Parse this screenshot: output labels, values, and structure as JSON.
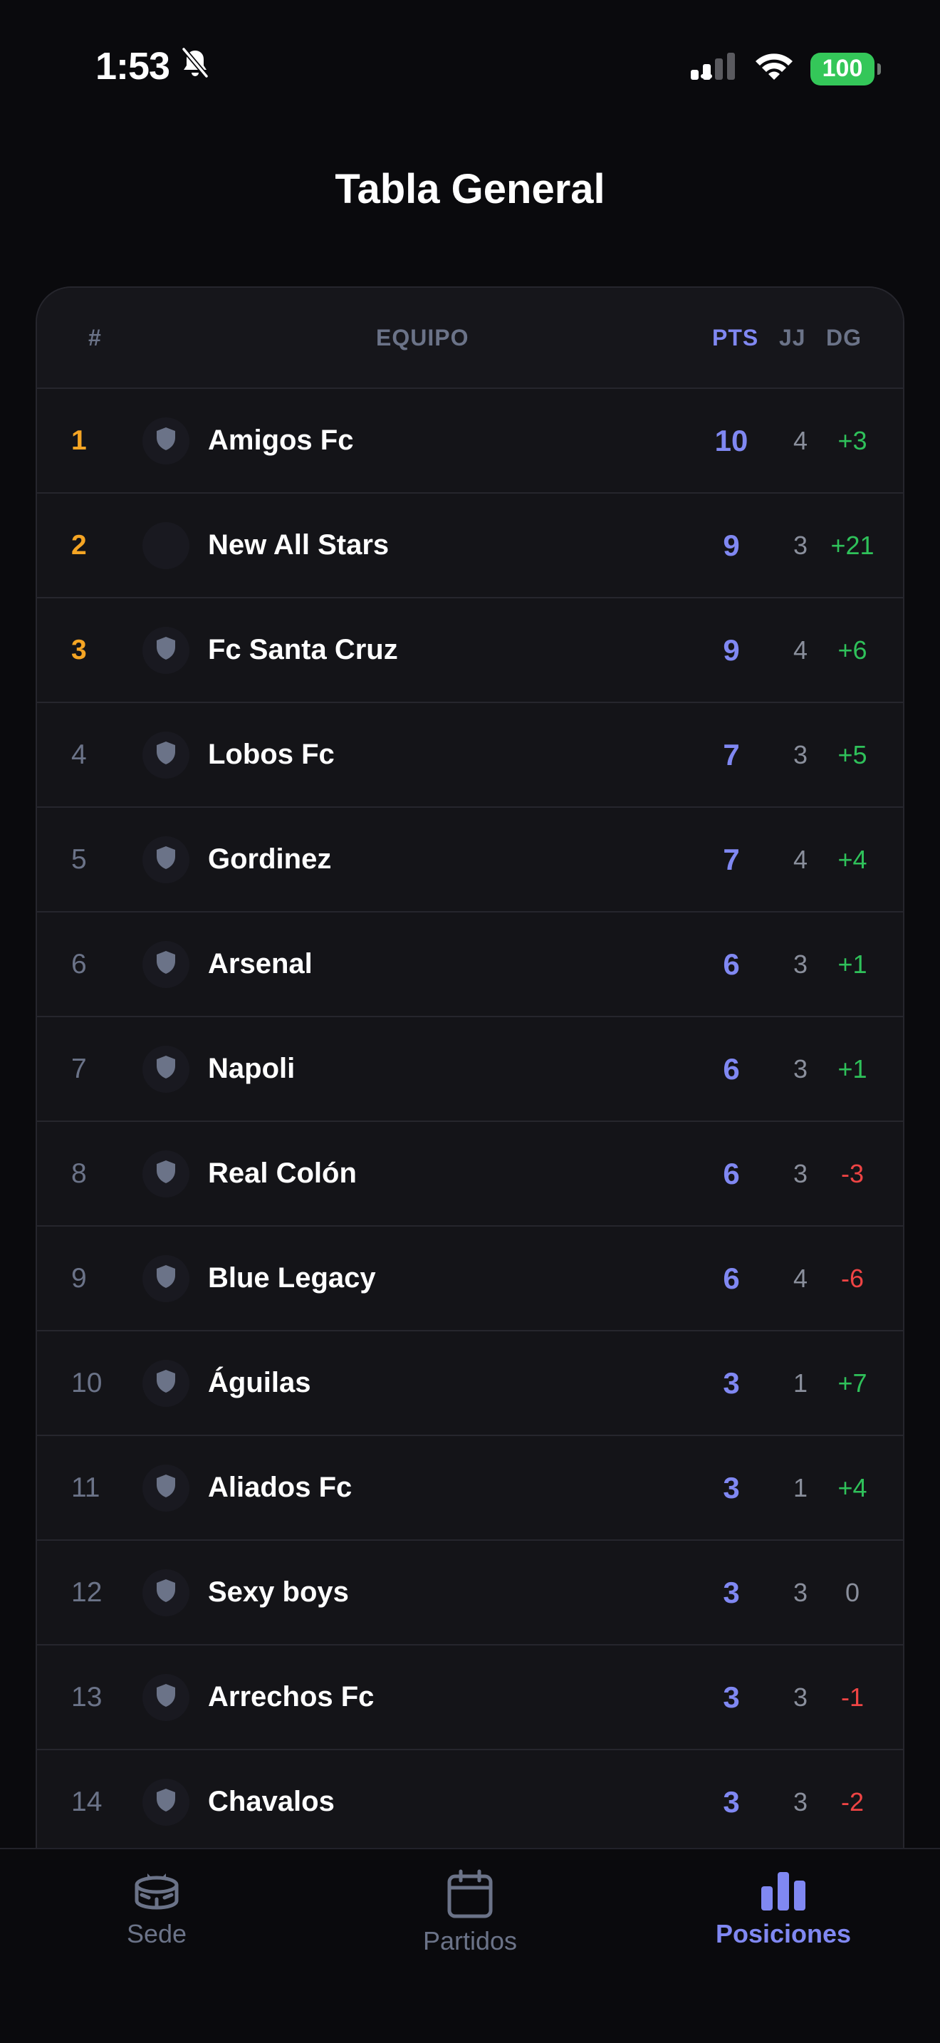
{
  "status_bar": {
    "time": "1:53",
    "battery": "100"
  },
  "page": {
    "title": "Tabla General"
  },
  "table": {
    "headers": {
      "rank": "#",
      "team": "EQUIPO",
      "pts": "PTS",
      "jj": "JJ",
      "dg": "DG"
    },
    "rows": [
      {
        "rank": "1",
        "team": "Amigos Fc",
        "pts": "10",
        "jj": "4",
        "dg": "+3",
        "badge": "shield-icon"
      },
      {
        "rank": "2",
        "team": "New All Stars",
        "pts": "9",
        "jj": "3",
        "dg": "+21",
        "badge": "none"
      },
      {
        "rank": "3",
        "team": "Fc Santa Cruz",
        "pts": "9",
        "jj": "4",
        "dg": "+6",
        "badge": "shield-icon"
      },
      {
        "rank": "4",
        "team": "Lobos Fc",
        "pts": "7",
        "jj": "3",
        "dg": "+5",
        "badge": "shield-icon"
      },
      {
        "rank": "5",
        "team": "Gordinez",
        "pts": "7",
        "jj": "4",
        "dg": "+4",
        "badge": "shield-icon"
      },
      {
        "rank": "6",
        "team": "Arsenal",
        "pts": "6",
        "jj": "3",
        "dg": "+1",
        "badge": "shield-icon"
      },
      {
        "rank": "7",
        "team": "Napoli",
        "pts": "6",
        "jj": "3",
        "dg": "+1",
        "badge": "shield-icon"
      },
      {
        "rank": "8",
        "team": "Real Colón",
        "pts": "6",
        "jj": "3",
        "dg": "-3",
        "badge": "shield-icon"
      },
      {
        "rank": "9",
        "team": "Blue Legacy",
        "pts": "6",
        "jj": "4",
        "dg": "-6",
        "badge": "shield-icon"
      },
      {
        "rank": "10",
        "team": "Águilas",
        "pts": "3",
        "jj": "1",
        "dg": "+7",
        "badge": "shield-icon"
      },
      {
        "rank": "11",
        "team": "Aliados Fc",
        "pts": "3",
        "jj": "1",
        "dg": "+4",
        "badge": "shield-icon"
      },
      {
        "rank": "12",
        "team": "Sexy boys",
        "pts": "3",
        "jj": "3",
        "dg": "0",
        "badge": "shield-icon"
      },
      {
        "rank": "13",
        "team": "Arrechos Fc",
        "pts": "3",
        "jj": "3",
        "dg": "-1",
        "badge": "shield-icon"
      },
      {
        "rank": "14",
        "team": "Chavalos",
        "pts": "3",
        "jj": "3",
        "dg": "-2",
        "badge": "shield-icon"
      }
    ]
  },
  "tab_bar": {
    "items": [
      {
        "label": "Sede",
        "icon": "stadium-icon"
      },
      {
        "label": "Partidos",
        "icon": "calendar-icon"
      },
      {
        "label": "Posiciones",
        "icon": "bar-chart-icon",
        "active": true
      }
    ]
  },
  "colors": {
    "background": "#0a0a0d",
    "accent": "#8088f2",
    "top_rank": "#f5a524",
    "positive": "#2fc15a",
    "negative": "#ef4444",
    "muted": "#6b7388"
  }
}
